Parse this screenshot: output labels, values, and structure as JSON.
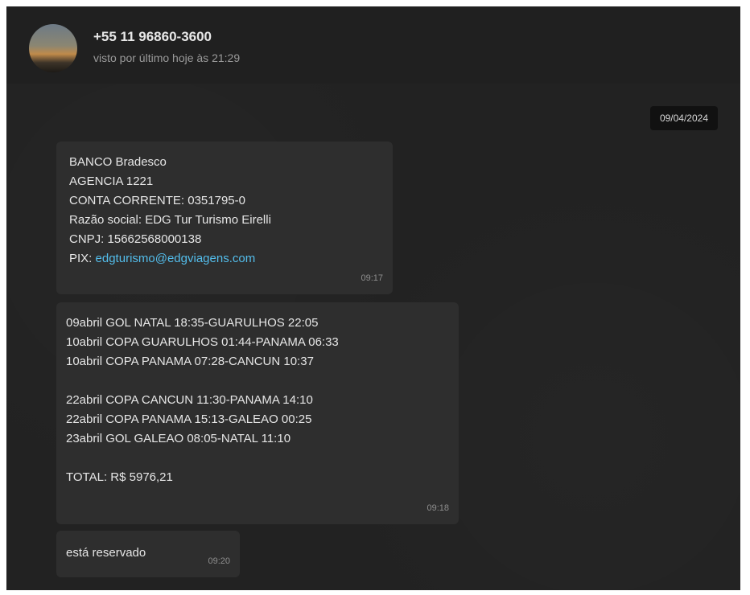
{
  "header": {
    "contact_name": "+55 11 96860-3600",
    "status": "visto por último hoje às 21:29"
  },
  "chat": {
    "date_chip": "09/04/2024",
    "messages": [
      {
        "lines": [
          "BANCO Bradesco",
          "AGENCIA 1221",
          "CONTA CORRENTE: 0351795-0",
          "Razão social: EDG Tur Turismo Eirelli",
          "CNPJ: 15662568000138"
        ],
        "pix_label": "PIX:",
        "pix_value": "edgturismo@edgviagens.com",
        "time": "09:17"
      },
      {
        "lines": [
          "09abril GOL NATAL 18:35-GUARULHOS 22:05",
          "10abril COPA GUARULHOS 01:44-PANAMA 06:33",
          "10abril COPA PANAMA 07:28-CANCUN 10:37",
          "",
          "22abril COPA CANCUN 11:30-PANAMA 14:10",
          "22abril COPA PANAMA 15:13-GALEAO 00:25",
          "23abril GOL GALEAO 08:05-NATAL 11:10",
          "",
          "TOTAL: R$ 5976,21"
        ],
        "time": "09:18"
      },
      {
        "text": "está reservado",
        "time": "09:20"
      }
    ]
  }
}
